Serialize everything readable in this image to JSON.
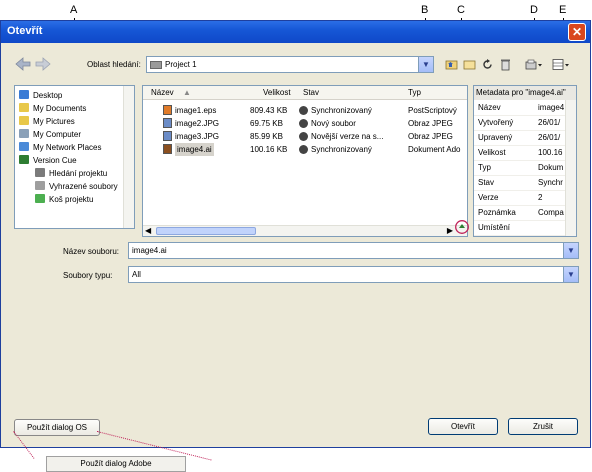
{
  "callouts": [
    "A",
    "B",
    "C",
    "D",
    "E"
  ],
  "window": {
    "title": "Otevřít",
    "look_in_label": "Oblast hledání:",
    "look_in_value": "Project 1"
  },
  "places": [
    {
      "label": "Desktop",
      "color": "#3a7bd5"
    },
    {
      "label": "My Documents",
      "color": "#e8c84a"
    },
    {
      "label": "My Pictures",
      "color": "#e8c84a"
    },
    {
      "label": "My Computer",
      "color": "#8aa0b8"
    },
    {
      "label": "My Network Places",
      "color": "#4a8ad8"
    },
    {
      "label": "Version Cue",
      "color": "#2e7d32"
    },
    {
      "label": "Hledání projektu",
      "color": "#7b7b7b"
    },
    {
      "label": "Vyhrazené soubory",
      "color": "#9e9e9e"
    },
    {
      "label": "Koš projektu",
      "color": "#4caf50"
    }
  ],
  "file_list": {
    "columns": [
      "Název",
      "Velikost",
      "Stav",
      "Typ"
    ],
    "rows": [
      {
        "name": "image1.eps",
        "size": "809.43 KB",
        "status": "Synchronizovaný",
        "type": "PostScriptový"
      },
      {
        "name": "image2.JPG",
        "size": "69.75 KB",
        "status": "Nový soubor",
        "type": "Obraz JPEG"
      },
      {
        "name": "image3.JPG",
        "size": "85.99 KB",
        "status": "Novější verze na s...",
        "type": "Obraz JPEG"
      },
      {
        "name": "image4.ai",
        "size": "100.16 KB",
        "status": "Synchronizovaný",
        "type": "Dokument Ado"
      }
    ],
    "selected_index": 3
  },
  "metadata": {
    "title": "Metadata pro \"image4.ai\"",
    "rows": [
      {
        "key": "Název",
        "value": "image4"
      },
      {
        "key": "Vytvořený",
        "value": "26/01/"
      },
      {
        "key": "Upravený",
        "value": "26/01/"
      },
      {
        "key": "Velikost",
        "value": "100.16"
      },
      {
        "key": "Typ",
        "value": "Dokum"
      },
      {
        "key": "Stav",
        "value": "Synchr"
      },
      {
        "key": "Verze",
        "value": "2"
      },
      {
        "key": "Poznámka",
        "value": "Compa"
      },
      {
        "key": "Umístění",
        "value": ""
      }
    ]
  },
  "form": {
    "filename_label": "Název souboru:",
    "filename_value": "image4.ai",
    "filetype_label": "Soubory typu:",
    "filetype_value": "All"
  },
  "buttons": {
    "use_os_dialog": "Použít dialog OS",
    "open": "Otevřít",
    "cancel": "Zrušit",
    "use_adobe_dialog": "Použít dialog Adobe"
  }
}
